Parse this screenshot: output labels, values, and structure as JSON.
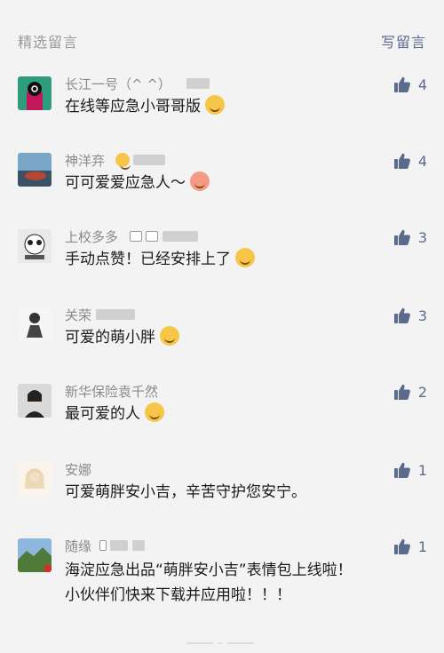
{
  "header": {
    "title": "精选留言",
    "write_label": "写留言"
  },
  "comments": [
    {
      "nickname": "长江一号（^ ^）",
      "text": "在线等应急小哥哥版",
      "likes": "4"
    },
    {
      "nickname": "神洋弃",
      "text": "可可爱爱应急人～",
      "likes": "4"
    },
    {
      "nickname": "上校多多",
      "text": "手动点赞！已经安排上了",
      "likes": "3"
    },
    {
      "nickname": "关荣",
      "text": "可爱的萌小胖",
      "likes": "3"
    },
    {
      "nickname": "新华保险袁千然",
      "text": "最可爱的人",
      "likes": "2"
    },
    {
      "nickname": "安娜",
      "text": "可爱萌胖安小吉，辛苦守护您安宁。",
      "likes": "1"
    },
    {
      "nickname": "随缘",
      "text_line1": "海淀应急出品“萌胖安小吉”表情包上线啦！",
      "text_line2": "小伙伴们快来下载并应用啦！！！",
      "likes": "1"
    }
  ],
  "colors": {
    "accent": "#5b6b8c",
    "muted": "#9a9a9a",
    "background": "#f3f3f3"
  },
  "icons": {
    "like": "thumbs-up-icon",
    "emoji": "emoji-icon"
  }
}
